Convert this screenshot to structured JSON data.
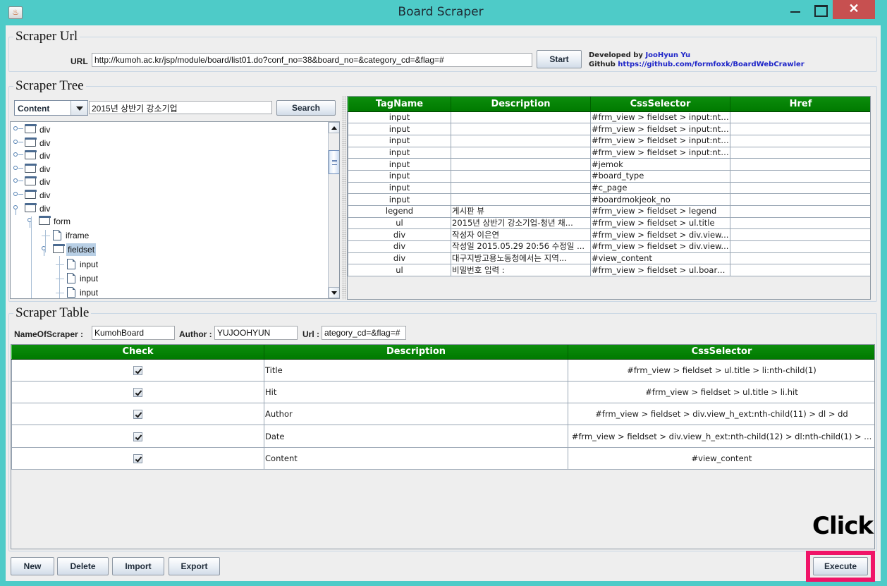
{
  "window": {
    "title": "Board Scraper",
    "app_icon": "java-coffee-icon",
    "controls": [
      "minimize",
      "maximize",
      "close"
    ],
    "close_glyph": "✕"
  },
  "scraper_url": {
    "group_title": "Scraper Url",
    "url_label": "URL",
    "url_value": "http://kumoh.ac.kr/jsp/module/board/list01.do?conf_no=38&board_no=&category_cd=&flag=#",
    "start_button": "Start",
    "credits": {
      "developed_by_label": "Developed by",
      "developer": "JooHyun Yu",
      "github_label": "Github",
      "github_url": "https://github.com/formfoxk/BoardWebCrawler"
    }
  },
  "scraper_tree": {
    "group_title": "Scraper Tree",
    "combo_selected": "Content",
    "search_value": "2015년 상반기 강소기업",
    "search_button": "Search",
    "tree_nodes": [
      {
        "label": "div",
        "type": "folder",
        "depth": 0,
        "expanded": false
      },
      {
        "label": "div",
        "type": "folder",
        "depth": 0,
        "expanded": false
      },
      {
        "label": "div",
        "type": "folder",
        "depth": 0,
        "expanded": false
      },
      {
        "label": "div",
        "type": "folder",
        "depth": 0,
        "expanded": false
      },
      {
        "label": "div",
        "type": "folder",
        "depth": 0,
        "expanded": false
      },
      {
        "label": "div",
        "type": "folder",
        "depth": 0,
        "expanded": false
      },
      {
        "label": "div",
        "type": "folder",
        "depth": 0,
        "expanded": true
      },
      {
        "label": "form",
        "type": "folder",
        "depth": 1,
        "expanded": true
      },
      {
        "label": "iframe",
        "type": "file",
        "depth": 2
      },
      {
        "label": "fieldset",
        "type": "folder",
        "depth": 2,
        "expanded": true,
        "selected": true
      },
      {
        "label": "input",
        "type": "file",
        "depth": 3
      },
      {
        "label": "input",
        "type": "file",
        "depth": 3
      },
      {
        "label": "input",
        "type": "file",
        "depth": 3
      }
    ],
    "scroll_position": 0.15,
    "table": {
      "columns": [
        "TagName",
        "Description",
        "CssSelector",
        "Href"
      ],
      "rows": [
        [
          "input",
          "",
          "#frm_view > fieldset > input:nth...",
          ""
        ],
        [
          "input",
          "",
          "#frm_view > fieldset > input:nth...",
          ""
        ],
        [
          "input",
          "",
          "#frm_view > fieldset > input:nth...",
          ""
        ],
        [
          "input",
          "",
          "#frm_view > fieldset > input:nth...",
          ""
        ],
        [
          "input",
          "",
          "#jemok",
          ""
        ],
        [
          "input",
          "",
          "#board_type",
          ""
        ],
        [
          "input",
          "",
          "#c_page",
          ""
        ],
        [
          "input",
          "",
          "#boardmokjeok_no",
          ""
        ],
        [
          "legend",
          "게시판 뷰",
          "#frm_view > fieldset > legend",
          ""
        ],
        [
          "ul",
          "2015년 상반기 강소기업-청년 채...",
          "#frm_view > fieldset > ul.title",
          ""
        ],
        [
          "div",
          "작성자 이은연",
          "#frm_view > fieldset > div.view...",
          ""
        ],
        [
          "div",
          "작성일 2015.05.29 20:56 수정일 ...",
          "#frm_view > fieldset > div.view...",
          ""
        ],
        [
          "div",
          "대구지방고용노동청에서는 지역...",
          "#view_content",
          ""
        ],
        [
          "ul",
          "비밀번호 입력 :",
          "#frm_view > fieldset > ul.board...",
          ""
        ]
      ]
    }
  },
  "scraper_table": {
    "group_title": "Scraper Table",
    "name_label": "NameOfScraper :",
    "name_value": "KumohBoard",
    "author_label": "Author :",
    "author_value": "YUJOOHYUN",
    "url_label": "Url :",
    "url_value": "ategory_cd=&flag=#",
    "columns": [
      "Check",
      "Description",
      "CssSelector"
    ],
    "rows": [
      {
        "checked": true,
        "description": "Title",
        "selector": "#frm_view > fieldset > ul.title > li:nth-child(1)"
      },
      {
        "checked": true,
        "description": "Hit",
        "selector": "#frm_view > fieldset > ul.title > li.hit"
      },
      {
        "checked": true,
        "description": "Author",
        "selector": "#frm_view > fieldset > div.view_h_ext:nth-child(11) > dl > dd"
      },
      {
        "checked": true,
        "description": "Date",
        "selector": "#frm_view > fieldset > div.view_h_ext:nth-child(12) > dl:nth-child(1) > ..."
      },
      {
        "checked": true,
        "description": "Content",
        "selector": "#view_content"
      }
    ]
  },
  "bottom_buttons": {
    "new": "New",
    "delete": "Delete",
    "import": "Import",
    "export": "Export",
    "execute": "Execute"
  },
  "annotation": {
    "click_text": "Click",
    "highlight_color": "#f01468"
  },
  "colors": {
    "titlebar": "#4ecbc8",
    "header_green": "#007a00",
    "close_red": "#c75050",
    "link_blue": "#1d24c8"
  }
}
